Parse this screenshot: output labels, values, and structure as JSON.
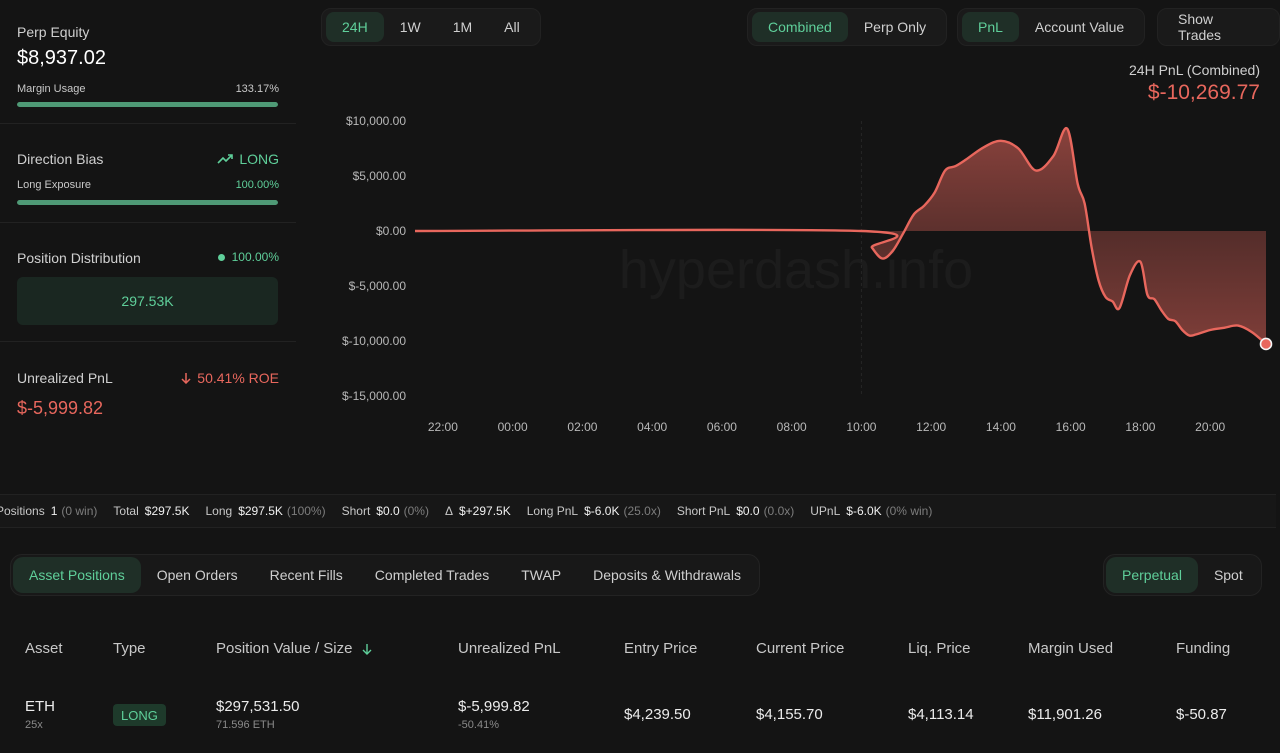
{
  "left": {
    "perp_equity_label": "Perp Equity",
    "perp_equity_value": "$8,937.02",
    "margin_usage_label": "Margin Usage",
    "margin_usage_value": "133.17%",
    "margin_usage_fill": 1.0,
    "direction_bias_label": "Direction Bias",
    "direction_bias_value": "LONG",
    "long_exposure_label": "Long Exposure",
    "long_exposure_value": "100.00%",
    "long_exposure_fill": 1.0,
    "position_dist_label": "Position Distribution",
    "position_dist_value": "100.00%",
    "position_dist_box": "297.53K",
    "unrealized_pnl_label": "Unrealized PnL",
    "unrealized_roe": "50.41% ROE",
    "unrealized_pnl_value": "$-5,999.82"
  },
  "ranges": [
    "24H",
    "1W",
    "1M",
    "All"
  ],
  "active_range": "24H",
  "modes": [
    "Combined",
    "Perp Only"
  ],
  "active_mode": "Combined",
  "metrics": [
    "PnL",
    "Account Value"
  ],
  "active_metric": "PnL",
  "show_trades_label": "Show Trades",
  "chart_header": {
    "label": "24H PnL (Combined)",
    "value": "$-10,269.77"
  },
  "watermark": "hyperdash.info",
  "chart_data": {
    "type": "area",
    "title": "24H PnL (Combined)",
    "ylim": [
      -15000,
      10000
    ],
    "y_ticks": [
      "$10,000.00",
      "$5,000.00",
      "$0.00",
      "$-5,000.00",
      "$-10,000.00",
      "$-15,000.00"
    ],
    "y_tick_values": [
      10000,
      5000,
      0,
      -5000,
      -10000,
      -15000
    ],
    "x_ticks": [
      "22:00",
      "00:00",
      "02:00",
      "04:00",
      "06:00",
      "08:00",
      "10:00",
      "12:00",
      "14:00",
      "16:00",
      "18:00",
      "20:00"
    ],
    "x_tick_hours": [
      0,
      2,
      4,
      6,
      8,
      10,
      12,
      14,
      16,
      18,
      20,
      22
    ],
    "xlim": [
      -0.8,
      23.6
    ],
    "series": [
      {
        "x": [
          -0.8,
          12.0,
          12.3,
          12.6,
          12.9,
          13.2,
          13.5,
          13.8,
          14.1,
          14.4,
          14.7,
          15.0,
          15.5,
          16.0,
          16.5,
          17.0,
          17.5,
          17.9,
          18.2,
          18.4,
          18.6,
          18.8,
          19.0,
          19.2,
          19.4,
          19.7,
          20.0,
          20.2,
          20.4,
          20.6,
          20.8,
          21.0,
          21.2,
          21.4,
          21.6,
          22.0,
          22.4,
          22.8,
          23.2,
          23.6
        ],
        "y": [
          0,
          0,
          -1500,
          -2500,
          -1800,
          -200,
          1500,
          2300,
          3500,
          5500,
          5900,
          6500,
          7600,
          8200,
          7500,
          5500,
          6800,
          9300,
          4300,
          2500,
          -1500,
          -4500,
          -6000,
          -6400,
          -7000,
          -4000,
          -2800,
          -5800,
          -6200,
          -7200,
          -8000,
          -8200,
          -9000,
          -9500,
          -9400,
          -9000,
          -8800,
          -8600,
          -9200,
          -10270
        ]
      }
    ]
  },
  "stats": [
    {
      "k": "Positions",
      "v": "1",
      "m": "(0 win)",
      "vc": ""
    },
    {
      "k": "Total",
      "v": "$297.5K",
      "m": "",
      "vc": ""
    },
    {
      "k": "Long",
      "v": "$297.5K",
      "m": "(100%)",
      "vc": ""
    },
    {
      "k": "Short",
      "v": "$0.0",
      "m": "(0%)",
      "vc": ""
    },
    {
      "k": "Δ",
      "v": "$+297.5K",
      "m": "",
      "vc": "green"
    },
    {
      "k": "Long PnL",
      "v": "$-6.0K",
      "m": "(25.0x)",
      "vc": "red"
    },
    {
      "k": "Short PnL",
      "v": "$0.0",
      "m": "(0.0x)",
      "vc": "green"
    },
    {
      "k": "UPnL",
      "v": "$-6.0K",
      "m": "(0% win)",
      "vc": "red"
    }
  ],
  "tabs": [
    "Asset Positions",
    "Open Orders",
    "Recent Fills",
    "Completed Trades",
    "TWAP",
    "Deposits & Withdrawals"
  ],
  "active_tab": "Asset Positions",
  "market_tabs": [
    "Perpetual",
    "Spot"
  ],
  "active_market_tab": "Perpetual",
  "table": {
    "headers": [
      "Asset",
      "Type",
      "Position Value / Size",
      "Unrealized PnL",
      "Entry Price",
      "Current Price",
      "Liq. Price",
      "Margin Used",
      "Funding"
    ],
    "rows": [
      {
        "asset": "ETH",
        "leverage": "25x",
        "type": "LONG",
        "position_value": "$297,531.50",
        "position_size": "71.596 ETH",
        "upnl": "$-5,999.82",
        "upnl_pct": "-50.41%",
        "entry_price": "$4,239.50",
        "current_price": "$4,155.70",
        "liq_price": "$4,113.14",
        "margin_used": "$11,901.26",
        "funding": "$-50.87"
      }
    ]
  }
}
